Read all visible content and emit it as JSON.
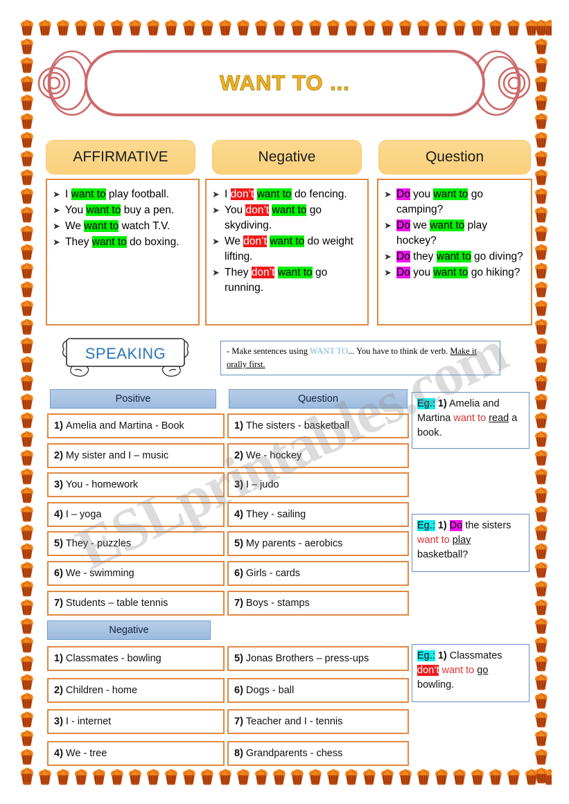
{
  "title": "WANT TO ...",
  "watermark": "ESLprintables.com",
  "tabs": [
    {
      "label": "AFFIRMATIVE"
    },
    {
      "label": "Negative"
    },
    {
      "label": "Question"
    }
  ],
  "grammar": {
    "affirmative": [
      [
        {
          "t": "I ",
          "h": "none"
        },
        {
          "t": "want to",
          "h": "green"
        },
        {
          "t": " play football.",
          "h": "none"
        }
      ],
      [
        {
          "t": "You ",
          "h": "none"
        },
        {
          "t": "want to",
          "h": "green"
        },
        {
          "t": " buy a pen.",
          "h": "none"
        }
      ],
      [
        {
          "t": "We ",
          "h": "none"
        },
        {
          "t": "want to",
          "h": "green"
        },
        {
          "t": " watch T.V.",
          "h": "none"
        }
      ],
      [
        {
          "t": "They ",
          "h": "none"
        },
        {
          "t": "want to",
          "h": "green"
        },
        {
          "t": " do boxing.",
          "h": "none"
        }
      ]
    ],
    "negative": [
      [
        {
          "t": "I ",
          "h": "none"
        },
        {
          "t": "don’t",
          "h": "red"
        },
        {
          "t": " ",
          "h": "none"
        },
        {
          "t": "want to",
          "h": "green"
        },
        {
          "t": " do fencing.",
          "h": "none"
        }
      ],
      [
        {
          "t": "You ",
          "h": "none"
        },
        {
          "t": "don’t",
          "h": "red"
        },
        {
          "t": " ",
          "h": "none"
        },
        {
          "t": "want to",
          "h": "green"
        },
        {
          "t": " go skydiving.",
          "h": "none"
        }
      ],
      [
        {
          "t": "We ",
          "h": "none"
        },
        {
          "t": "don’t",
          "h": "red"
        },
        {
          "t": " ",
          "h": "none"
        },
        {
          "t": "want to",
          "h": "green"
        },
        {
          "t": " do weight lifting.",
          "h": "none"
        }
      ],
      [
        {
          "t": "They ",
          "h": "none"
        },
        {
          "t": "don’t",
          "h": "red"
        },
        {
          "t": " ",
          "h": "none"
        },
        {
          "t": "want to",
          "h": "green"
        },
        {
          "t": " go running.",
          "h": "none"
        }
      ]
    ],
    "question": [
      [
        {
          "t": "Do",
          "h": "mag"
        },
        {
          "t": " you ",
          "h": "none"
        },
        {
          "t": "want to",
          "h": "green"
        },
        {
          "t": " go camping?",
          "h": "none"
        }
      ],
      [
        {
          "t": "Do",
          "h": "mag"
        },
        {
          "t": " we ",
          "h": "none"
        },
        {
          "t": "want to",
          "h": "green"
        },
        {
          "t": " play hockey?",
          "h": "none"
        }
      ],
      [
        {
          "t": "Do",
          "h": "mag"
        },
        {
          "t": " they ",
          "h": "none"
        },
        {
          "t": "want to",
          "h": "green"
        },
        {
          "t": " go diving?",
          "h": "none"
        }
      ],
      [
        {
          "t": "Do",
          "h": "mag"
        },
        {
          "t": " you ",
          "h": "none"
        },
        {
          "t": "want to",
          "h": "green"
        },
        {
          "t": " go hiking?",
          "h": "none"
        }
      ]
    ]
  },
  "speaking": {
    "label": "SPEAKING"
  },
  "instruction": {
    "prefix": "- Make sentences using ",
    "keyword": "WANT TO",
    "middle": "... You have to think de verb. ",
    "underlined": "Make it orally first."
  },
  "columns": {
    "positive_header": "Positive",
    "question_header": "Question",
    "negative_header": "Negative"
  },
  "positive_items": [
    {
      "n": "1)",
      "text": "Amelia and Martina - Book"
    },
    {
      "n": "2)",
      "text": "My sister and I – music"
    },
    {
      "n": "3)",
      "text": "You - homework"
    },
    {
      "n": "4)",
      "text": "I – yoga"
    },
    {
      "n": "5)",
      "text": "They - puzzles"
    },
    {
      "n": "6)",
      "text": "We - swimming"
    },
    {
      "n": "7)",
      "text": "Students – table tennis"
    }
  ],
  "question_items": [
    {
      "n": "1)",
      "text": "The sisters - basketball"
    },
    {
      "n": "2)",
      "text": "We - hockey"
    },
    {
      "n": "3)",
      "text": "I – judo"
    },
    {
      "n": "4)",
      "text": "They - sailing"
    },
    {
      "n": "5)",
      "text": "My parents - aerobics"
    },
    {
      "n": "6)",
      "text": "Girls - cards"
    },
    {
      "n": "7)",
      "text": "Boys - stamps"
    }
  ],
  "negative_items_left": [
    {
      "n": "1)",
      "text": "Classmates - bowling"
    },
    {
      "n": "2)",
      "text": "Children - home"
    },
    {
      "n": "3)",
      "text": "I - internet"
    },
    {
      "n": "4)",
      "text": "We - tree"
    }
  ],
  "negative_items_right": [
    {
      "n": "5)",
      "text": "Jonas Brothers – press-ups"
    },
    {
      "n": "6)",
      "text": "Dogs - ball"
    },
    {
      "n": "7)",
      "text": "Teacher and I - tennis"
    },
    {
      "n": "8)",
      "text": "Grandparents - chess"
    }
  ],
  "examples": [
    {
      "id": "example-positive",
      "parts": [
        {
          "t": "Eg.:",
          "s": "cyan"
        },
        {
          "t": " ",
          "s": "none"
        },
        {
          "t": "1)",
          "s": "bold"
        },
        {
          "t": " Amelia and Martina ",
          "s": "none"
        },
        {
          "t": "want to",
          "s": "red"
        },
        {
          "t": " ",
          "s": "none"
        },
        {
          "t": "read",
          "s": "underline"
        },
        {
          "t": " a book.",
          "s": "none"
        }
      ]
    },
    {
      "id": "example-question",
      "parts": [
        {
          "t": "Eg.:",
          "s": "cyan"
        },
        {
          "t": " ",
          "s": "none"
        },
        {
          "t": "1)",
          "s": "bold"
        },
        {
          "t": " ",
          "s": "none"
        },
        {
          "t": "Do",
          "s": "mag"
        },
        {
          "t": " the sisters ",
          "s": "none"
        },
        {
          "t": "want to",
          "s": "red"
        },
        {
          "t": " ",
          "s": "none"
        },
        {
          "t": "play",
          "s": "underline"
        },
        {
          "t": " basketball?",
          "s": "none"
        }
      ]
    },
    {
      "id": "example-negative",
      "parts": [
        {
          "t": "Eg.:",
          "s": "cyan"
        },
        {
          "t": " ",
          "s": "none"
        },
        {
          "t": "1)",
          "s": "bold"
        },
        {
          "t": " Classmates ",
          "s": "none"
        },
        {
          "t": "don’t",
          "s": "redbg"
        },
        {
          "t": " ",
          "s": "none"
        },
        {
          "t": "want to",
          "s": "red"
        },
        {
          "t": " ",
          "s": "none"
        },
        {
          "t": "go",
          "s": "underline"
        },
        {
          "t": " bowling.",
          "s": "none"
        }
      ]
    }
  ],
  "colors": {
    "highlight_green": "#00f000",
    "highlight_red": "#ef1a1a",
    "highlight_magenta": "#ee15ee",
    "highlight_cyan": "#19e9e9",
    "cell_border_orange": "#e08840",
    "tab_gold": "#fad17d",
    "header_blue": "#9dbbdf",
    "title_gold": "#f0b528",
    "banner_rose": "#cd6a6a",
    "speaking_blue": "#2a76b8",
    "example_red_text": "#e03030"
  }
}
